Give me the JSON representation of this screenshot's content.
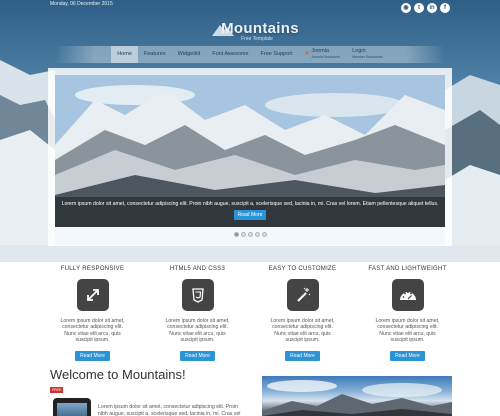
{
  "top": {
    "date": "Monday, 06 December 2015",
    "social": [
      {
        "icon": "rss-icon",
        "glyph": "◉"
      },
      {
        "icon": "twitter-icon",
        "glyph": "t"
      },
      {
        "icon": "linkedin-icon",
        "glyph": "in"
      },
      {
        "icon": "facebook-icon",
        "glyph": "f"
      }
    ]
  },
  "logo": {
    "name": "Mountains",
    "tagline": "Free Template"
  },
  "nav": {
    "items": [
      {
        "label": "Home",
        "active": true
      },
      {
        "label": "Features"
      },
      {
        "label": "Widgetkit"
      },
      {
        "label": "Font Awesome"
      },
      {
        "label": "Free Support"
      }
    ],
    "joomla": {
      "label": "Joomla",
      "sub": "Joomla Resources"
    },
    "login": {
      "label": "Login",
      "sub": "Member Resources"
    }
  },
  "slider": {
    "caption": "Lorem ipsum dolor sit amet, consectetur adipiscing elit. Proin nibh augue, suscipit a, scelerisque sed, lacinia in, mi. Cras vel lorem. Etiam pellentesque aliquet tellus.",
    "button": "Read More",
    "dots": 5,
    "active_dot": 0
  },
  "features": [
    {
      "title": "FULLY RESPONSIVE",
      "icon": "expand-arrows-icon",
      "text": "Lorem ipsum dolor sit amet, consectetur adipiscing elit. Nunc vitae elit arcu, quis suscipit ipsum.",
      "button": "Read More"
    },
    {
      "title": "HTML5 AND CSS3",
      "icon": "css3-icon",
      "text": "Lorem ipsum dolor sit amet, consectetur adipiscing elit. Nunc vitae elit arcu, quis suscipit ipsum.",
      "button": "Read More"
    },
    {
      "title": "EASY TO CUSTOMIZE",
      "icon": "magic-wand-icon",
      "text": "Lorem ipsum dolor sit amet, consectetur adipiscing elit. Nunc vitae elit arcu, quis suscipit ipsum.",
      "button": "Read More"
    },
    {
      "title": "FAST AND LIGHTWEIGHT",
      "icon": "dashboard-icon",
      "text": "Lorem ipsum dolor sit amet, consectetur adipiscing elit. Nunc vitae elit arcu, quis suscipit ipsum.",
      "button": "Read More"
    }
  ],
  "welcome": {
    "title": "Welcome to Mountains!",
    "badge": "FREE",
    "text": "Lorem ipsum dolor sit amet, consectetur adipiscing elit. Proin nibh augue, suscipit a, scelerisque sed, lacinia in, mi. Cras vel lorem."
  },
  "colors": {
    "accent": "#2a94d6",
    "icon_bg": "#444444",
    "badge": "#d32f2f"
  }
}
